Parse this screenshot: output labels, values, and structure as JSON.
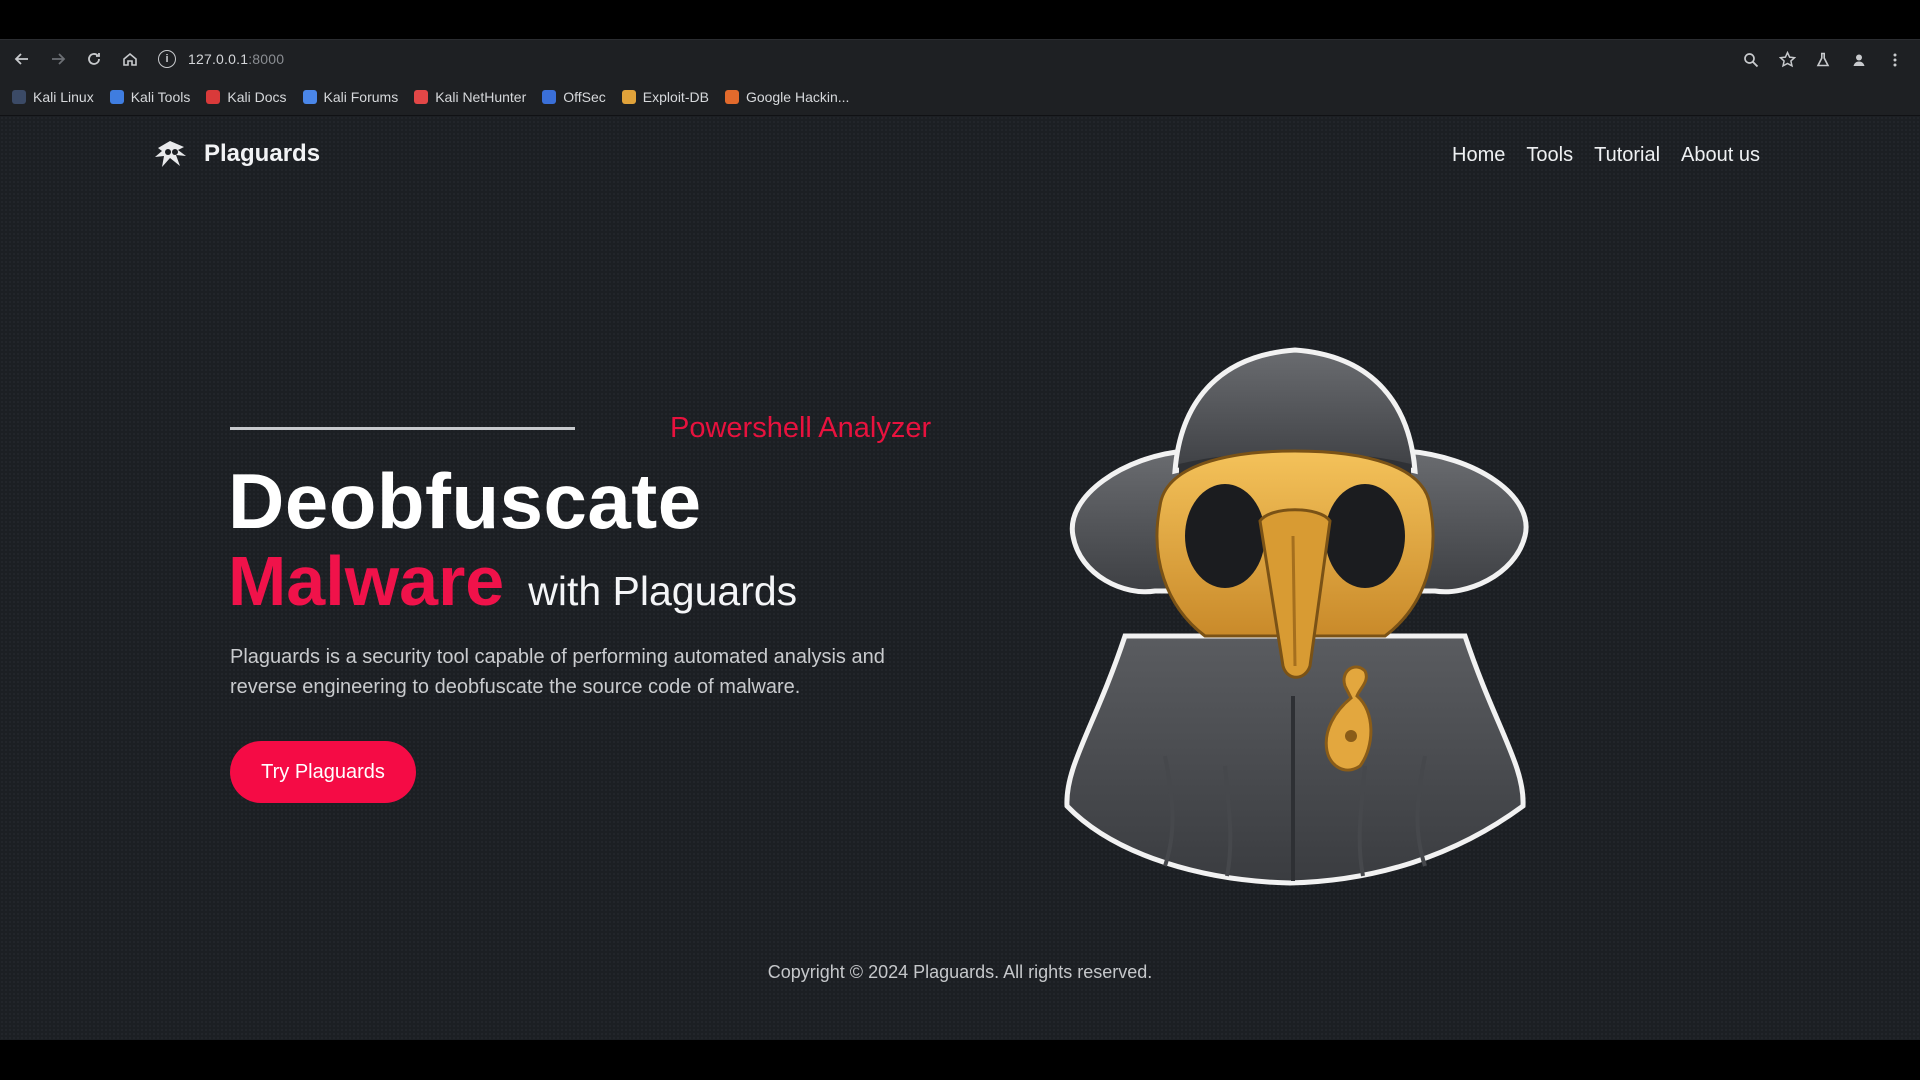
{
  "browser": {
    "url_host": "127.0.0.1",
    "url_port": ":8000",
    "nav_icons": [
      "back-arrow-icon",
      "forward-arrow-icon",
      "reload-icon",
      "home-icon"
    ],
    "right_icons": [
      "zoom-icon",
      "star-icon",
      "labs-flask-icon",
      "profile-icon",
      "menu-dots-icon"
    ],
    "bookmarks": [
      {
        "label": "Kali Linux",
        "color": "#3b4a66"
      },
      {
        "label": "Kali Tools",
        "color": "#3f7de0"
      },
      {
        "label": "Kali Docs",
        "color": "#d93a3a"
      },
      {
        "label": "Kali Forums",
        "color": "#4a86e8"
      },
      {
        "label": "Kali NetHunter",
        "color": "#e24747"
      },
      {
        "label": "OffSec",
        "color": "#3a6fd8"
      },
      {
        "label": "Exploit-DB",
        "color": "#e0a23a"
      },
      {
        "label": "Google Hackin...",
        "color": "#e26a2c"
      }
    ]
  },
  "site": {
    "brand": "Plaguards",
    "menu": [
      "Home",
      "Tools",
      "Tutorial",
      "About us"
    ],
    "hero": {
      "eyebrow": "Powershell Analyzer",
      "title_line1": "Deobfuscate",
      "title_accent": "Malware",
      "title_suffix": "with Plaguards",
      "description": "Plaguards is a security tool capable of performing automated analysis and reverse engineering to deobfuscate the source code of malware.",
      "cta": "Try Plaguards"
    },
    "footer": "Copyright © 2024 Plaguards. All rights reserved."
  },
  "colors": {
    "accent": "#f50b45",
    "page_bg": "#1c1f23",
    "chrome_bg": "#1e2023"
  }
}
